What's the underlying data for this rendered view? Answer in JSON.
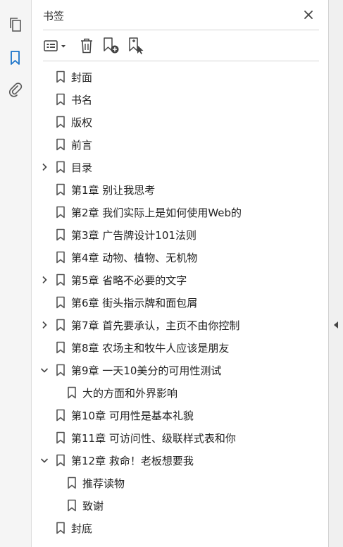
{
  "panel": {
    "title": "书签"
  },
  "icons": {
    "rail": [
      "pages-icon",
      "bookmark-icon",
      "attachment-icon"
    ],
    "toolbar": [
      "options-menu-icon",
      "delete-icon",
      "new-bookmark-icon",
      "new-bookmark-from-structure-icon"
    ],
    "accent": "#1a73c9",
    "icon_gray": "#5a5a5a"
  },
  "bookmarks": [
    {
      "label": "封面",
      "level": 0,
      "expander": "none"
    },
    {
      "label": "书名",
      "level": 0,
      "expander": "none"
    },
    {
      "label": "版权",
      "level": 0,
      "expander": "none"
    },
    {
      "label": "前言",
      "level": 0,
      "expander": "none"
    },
    {
      "label": "目录",
      "level": 0,
      "expander": "collapsed"
    },
    {
      "label": "第1章  别让我思考",
      "level": 0,
      "expander": "none"
    },
    {
      "label": "第2章  我们实际上是如何使用Web的",
      "level": 0,
      "expander": "none"
    },
    {
      "label": "第3章  广告牌设计101法则",
      "level": 0,
      "expander": "none"
    },
    {
      "label": "第4章  动物、植物、无机物",
      "level": 0,
      "expander": "none"
    },
    {
      "label": "第5章  省略不必要的文字",
      "level": 0,
      "expander": "collapsed"
    },
    {
      "label": "第6章  街头指示牌和面包屑",
      "level": 0,
      "expander": "none"
    },
    {
      "label": "第7章  首先要承认，主页不由你控制",
      "level": 0,
      "expander": "collapsed"
    },
    {
      "label": "第8章  农场主和牧牛人应该是朋友",
      "level": 0,
      "expander": "none"
    },
    {
      "label": "第9章  一天10美分的可用性测试",
      "level": 0,
      "expander": "expanded"
    },
    {
      "label": "大的方面和外界影响",
      "level": 1,
      "expander": "none"
    },
    {
      "label": "第10章  可用性是基本礼貌",
      "level": 0,
      "expander": "none"
    },
    {
      "label": "第11章  可访问性、级联样式表和你",
      "level": 0,
      "expander": "none"
    },
    {
      "label": "第12章  救命！老板想要我",
      "level": 0,
      "expander": "expanded"
    },
    {
      "label": "推荐读物",
      "level": 1,
      "expander": "none"
    },
    {
      "label": "致谢",
      "level": 1,
      "expander": "none"
    },
    {
      "label": "封底",
      "level": 0,
      "expander": "none"
    }
  ]
}
